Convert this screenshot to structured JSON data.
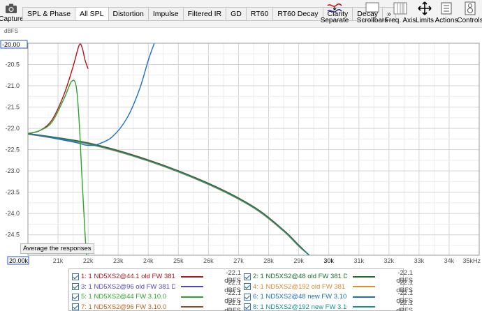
{
  "toolbar": {
    "capture_label": "Capture",
    "tabs": [
      {
        "label": "SPL & Phase",
        "active": false
      },
      {
        "label": "All SPL",
        "active": true
      },
      {
        "label": "Distortion",
        "active": false
      },
      {
        "label": "Impulse",
        "active": false
      },
      {
        "label": "Filtered IR",
        "active": false
      },
      {
        "label": "GD",
        "active": false
      },
      {
        "label": "RT60",
        "active": false
      },
      {
        "label": "RT60 Decay",
        "active": false
      },
      {
        "label": "Clarity",
        "active": false
      },
      {
        "label": "Decay",
        "active": false
      },
      {
        "label": "»",
        "active": false
      }
    ],
    "buttons": {
      "separate": "Separate",
      "scrollbars": "Scrollbars",
      "freq_axis": "Freq. Axis",
      "limits": "Limits",
      "actions": "Actions",
      "controls": "Controls"
    }
  },
  "chart_data": {
    "type": "line",
    "ylabel": "dBFS",
    "ylim": [
      -24.98,
      -20.0
    ],
    "xlim": [
      20000,
      35000
    ],
    "y_top_label": "-20.00",
    "x_left_label": "20.00k",
    "y_ticks": [
      "-20.5",
      "-21.0",
      "-21.5",
      "-22.0",
      "-22.5",
      "-23.0",
      "-23.5",
      "-24.0",
      "-24.5"
    ],
    "x_ticks": [
      "21k",
      "22k",
      "23k",
      "24k",
      "25k",
      "26k",
      "27k",
      "28k",
      "29k",
      "30k",
      "31k",
      "32k",
      "33k",
      "34k",
      "35kHz"
    ],
    "grid": true,
    "series": [
      {
        "name": "1: 1 ND5XS2@44.1 old FW 381",
        "color": "#b0141e",
        "x": [
          20000,
          20400,
          20800,
          21200,
          21500,
          21700,
          21800,
          21900,
          22000
        ],
        "y": [
          -22.12,
          -22.05,
          -21.8,
          -21.2,
          -20.55,
          -20.05,
          -20.1,
          -20.4,
          -20.6
        ]
      },
      {
        "name": "2: 1 ND5XS2@48 old FW 381 D",
        "color": "#1b6b2c",
        "x": [
          20000,
          22000,
          24000,
          26000,
          27500,
          28500,
          29000,
          29350
        ],
        "y": [
          -22.12,
          -22.35,
          -22.75,
          -23.3,
          -23.85,
          -24.4,
          -24.75,
          -24.98
        ]
      },
      {
        "name": "3: 1 ND5XS2@96 old FW 381 D",
        "color": "#5046c8",
        "x": [
          20000,
          22000,
          24000,
          26000,
          27500,
          28500,
          29000,
          29350
        ],
        "y": [
          -22.13,
          -22.36,
          -22.76,
          -23.31,
          -23.86,
          -24.41,
          -24.76,
          -24.98
        ]
      },
      {
        "name": "4: 1 ND5XS2@192 old FW 381",
        "color": "#e08a2e",
        "x": [
          20000,
          22000,
          24000,
          26000,
          27500,
          28500,
          29000,
          29350
        ],
        "y": [
          -22.14,
          -22.37,
          -22.77,
          -23.32,
          -23.87,
          -24.42,
          -24.77,
          -24.98
        ]
      },
      {
        "name": "5: 1 ND5XS2@44  FW 3.10.0",
        "color": "#2aa62a",
        "x": [
          20000,
          20400,
          20800,
          21200,
          21450,
          21600,
          21700,
          21800,
          21900,
          21950
        ],
        "y": [
          -22.12,
          -22.05,
          -21.85,
          -21.3,
          -20.9,
          -21.0,
          -21.8,
          -23.2,
          -24.5,
          -24.98
        ]
      },
      {
        "name": "6: 1 ND5XS2@48 new FW 3.10.",
        "color": "#1d6fc4",
        "x": [
          20000,
          21500,
          21900,
          22100,
          22300,
          22800,
          23300,
          23700,
          24000,
          24200
        ],
        "y": [
          -22.12,
          -22.32,
          -22.39,
          -22.4,
          -22.38,
          -22.2,
          -21.75,
          -21.1,
          -20.4,
          -20.0
        ]
      },
      {
        "name": "7: 1 ND5XS2@96  FW 3.10.0",
        "color": "#8a4a22",
        "x": [
          20000,
          22000,
          24000,
          26000,
          27500,
          28500,
          29000,
          29350
        ],
        "y": [
          -22.12,
          -22.34,
          -22.74,
          -23.29,
          -23.84,
          -24.39,
          -24.74,
          -24.98
        ]
      },
      {
        "name": "8: 1 ND5XS2@192 new FW 3.10",
        "color": "#168f8f",
        "x": [
          20000,
          22000,
          24000,
          26000,
          27500,
          28500,
          29000,
          29350
        ],
        "y": [
          -22.13,
          -22.36,
          -22.76,
          -23.31,
          -23.86,
          -24.41,
          -24.76,
          -24.98
        ]
      }
    ]
  },
  "average_button": "Average the responses",
  "legend": [
    {
      "label": "1: 1 ND5XS2@44.1 old FW 381",
      "value": "-22.1 dBFS",
      "color": "#b0141e",
      "text_color": "#b0141e"
    },
    {
      "label": "2: 1 ND5XS2@48 old FW 381 D",
      "value": "-22.1 dBFS",
      "color": "#1b6b2c",
      "text_color": "#1b6b2c"
    },
    {
      "label": "3: 1 ND5XS2@96 old FW 381 D",
      "value": "-22.1 dBFS",
      "color": "#5046c8",
      "text_color": "#5046c8"
    },
    {
      "label": "4: 1 ND5XS2@192 old FW 381",
      "value": "-22.1 dBFS",
      "color": "#e08a2e",
      "text_color": "#e08a2e"
    },
    {
      "label": "5: 1 ND5XS2@44  FW 3.10.0",
      "value": "-22.1 dBFS",
      "color": "#2aa62a",
      "text_color": "#2aa62a"
    },
    {
      "label": "6: 1 ND5XS2@48 new FW 3.10.",
      "value": "-22.1 dBFS",
      "color": "#1d6fc4",
      "text_color": "#1d6fc4"
    },
    {
      "label": "7: 1 ND5XS2@96  FW 3.10.0",
      "value": "-22.1 dBFS",
      "color": "#8a4a22",
      "text_color": "#c0641e"
    },
    {
      "label": "8: 1 ND5XS2@192 new FW 3.10",
      "value": "-22.1 dBFS",
      "color": "#168f8f",
      "text_color": "#168f8f"
    }
  ]
}
